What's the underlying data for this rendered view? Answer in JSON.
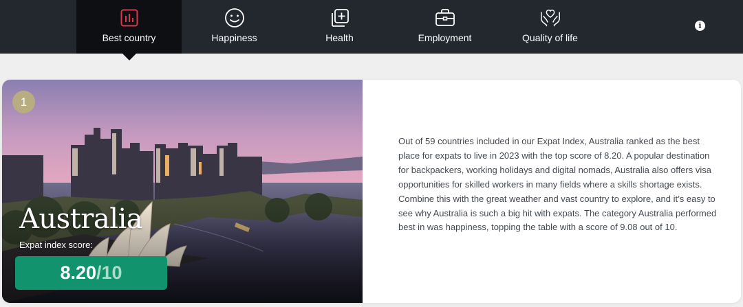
{
  "nav": {
    "tabs": [
      {
        "label": "Best country",
        "icon": "bar-chart-icon",
        "active": true
      },
      {
        "label": "Happiness",
        "icon": "smiley-icon",
        "active": false
      },
      {
        "label": "Health",
        "icon": "medical-plus-icon",
        "active": false
      },
      {
        "label": "Employment",
        "icon": "briefcase-icon",
        "active": false
      },
      {
        "label": "Quality of life",
        "icon": "heart-hands-icon",
        "active": false
      }
    ],
    "info_icon": "i"
  },
  "card": {
    "rank": "1",
    "country": "Australia",
    "score_label": "Expat index score:",
    "score_value": "8.20",
    "score_max": "/10",
    "description": "Out of 59 countries included in our Expat Index, Australia ranked as the best place for expats to live in 2023 with the top score of 8.20. A popular destination for backpackers, working holidays and digital nomads, Australia also offers visa opportunities for skilled workers in many fields where a skills shortage exists. Combine this with the great weather and vast country to explore, and it’s easy to see why Australia is such a big hit with expats. The category Australia performed best in was happiness, topping the table with a score of 9.08 out of 10."
  },
  "colors": {
    "nav_bg": "#23272e",
    "nav_active": "#0d0f12",
    "accent_red": "#e0334d",
    "score_green": "#11936d",
    "rank_badge": "#b8ad80"
  }
}
